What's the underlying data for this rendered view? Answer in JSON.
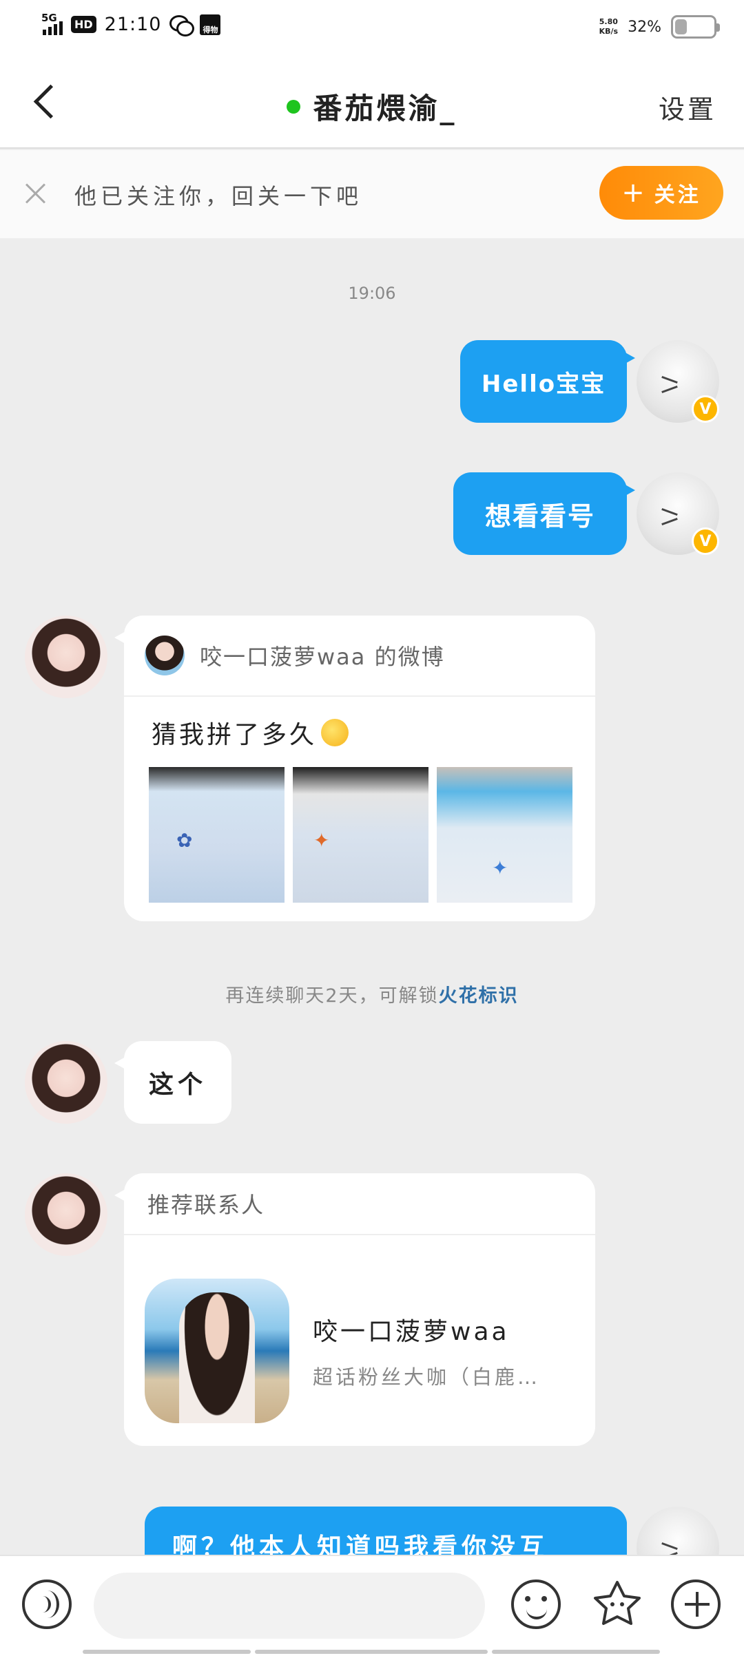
{
  "status_bar": {
    "network": "5G",
    "hd": "HD",
    "time": "21:10",
    "app_badge": "得物",
    "speed_value": "5.80",
    "speed_unit": "KB/s",
    "battery": "32%",
    "battery_level": 0.32
  },
  "header": {
    "title": "番茄煨渝_",
    "settings_label": "设置",
    "online_color": "#1ec41e"
  },
  "follow_banner": {
    "text": "他已关注你，回关一下吧",
    "button_label": "关注"
  },
  "chat": {
    "timestamp": "19:06",
    "messages_out": [
      "Hello宝宝",
      "想看看号"
    ],
    "self_badge": "V",
    "weibo_card": {
      "source": "咬一口菠萝waa 的微博",
      "text": "猜我拼了多久"
    },
    "notice": {
      "text": "再连续聊天2天，可解锁",
      "highlight": "火花标识"
    },
    "incoming_text": "这个",
    "contact_card": {
      "header": "推荐联系人",
      "name": "咬一口菠萝waa",
      "description": "超话粉丝大咖（白鹿…"
    },
    "last_out": "啊？他本人知道吗我看你没互"
  },
  "input_bar": {
    "placeholder": ""
  },
  "colors": {
    "bubble_blue": "#1da0f2",
    "follow_orange": "#ff8b08",
    "badge_gold": "#fdb600",
    "link_blue": "#2f70a8"
  }
}
